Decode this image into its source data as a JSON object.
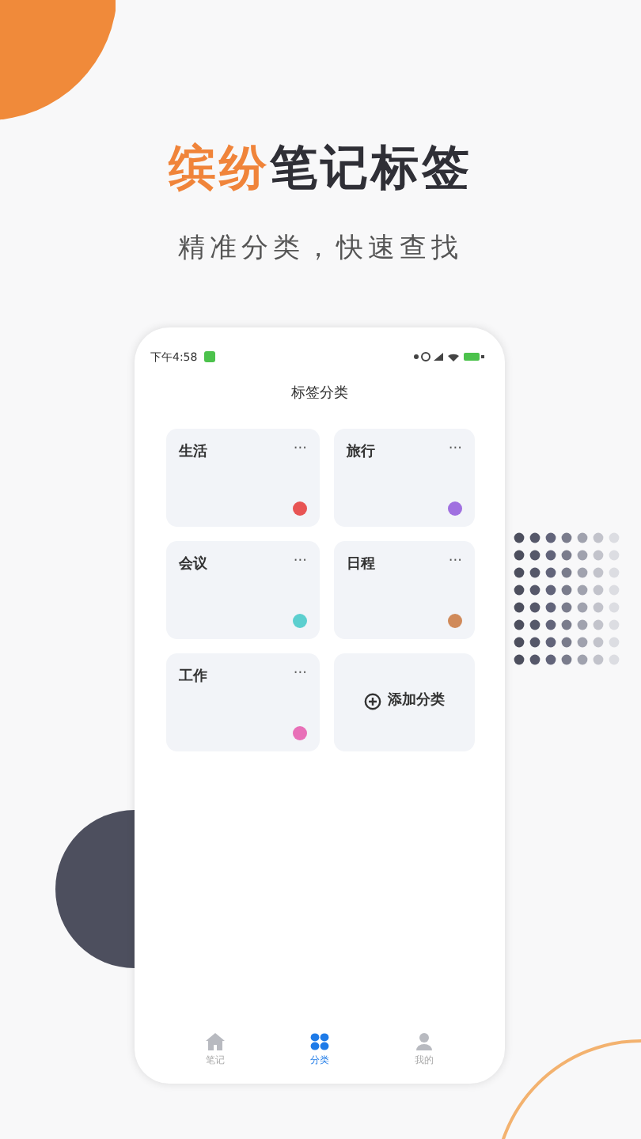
{
  "headline": {
    "accent": "缤纷",
    "rest": "笔记标签"
  },
  "subtitle": "精准分类，快速查找",
  "phone": {
    "status_bar": {
      "time": "下午4:58"
    },
    "title": "标签分类",
    "cards": [
      {
        "kind": "tag",
        "name": "生活",
        "menu": "···",
        "color": "#e85454"
      },
      {
        "kind": "tag",
        "name": "旅行",
        "menu": "···",
        "color": "#a070e0"
      },
      {
        "kind": "tag",
        "name": "会议",
        "menu": "···",
        "color": "#5ccfcf"
      },
      {
        "kind": "tag",
        "name": "日程",
        "menu": "···",
        "color": "#d08a5a"
      },
      {
        "kind": "tag",
        "name": "工作",
        "menu": "···",
        "color": "#e870b8"
      },
      {
        "kind": "add",
        "name": "添加分类"
      }
    ],
    "tab_bar": [
      {
        "kind": "home",
        "label": "笔记",
        "selected": false
      },
      {
        "kind": "grid",
        "label": "分类",
        "selected": true
      },
      {
        "kind": "person",
        "label": "我的",
        "selected": false
      }
    ]
  }
}
